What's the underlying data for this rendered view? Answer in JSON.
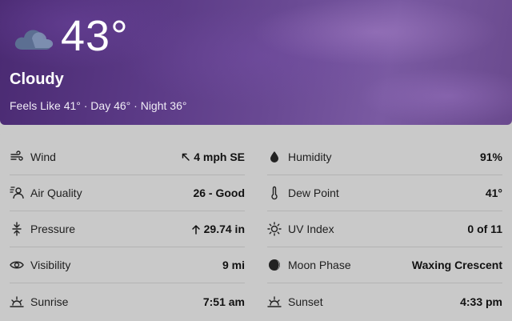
{
  "current": {
    "icon": "cloud-icon",
    "temperature": "43°",
    "condition": "Cloudy",
    "summary": "Feels Like 41° · Day 46° · Night 36°"
  },
  "details": {
    "left": [
      {
        "icon": "wind-icon",
        "label": "Wind",
        "value": "4 mph SE",
        "prefix_icon": "arrow-up-left-icon"
      },
      {
        "icon": "air-quality-icon",
        "label": "Air Quality",
        "value": "26 - Good"
      },
      {
        "icon": "pressure-icon",
        "label": "Pressure",
        "value": "29.74 in",
        "prefix_icon": "arrow-up-icon"
      },
      {
        "icon": "eye-icon",
        "label": "Visibility",
        "value": "9 mi"
      },
      {
        "icon": "sunrise-icon",
        "label": "Sunrise",
        "value": "7:51 am"
      }
    ],
    "right": [
      {
        "icon": "droplet-icon",
        "label": "Humidity",
        "value": "91%"
      },
      {
        "icon": "thermometer-icon",
        "label": "Dew Point",
        "value": "41°"
      },
      {
        "icon": "sun-outline-icon",
        "label": "UV Index",
        "value": "0 of 11"
      },
      {
        "icon": "moon-phase-icon",
        "label": "Moon Phase",
        "value": "Waxing Crescent"
      },
      {
        "icon": "sunset-icon",
        "label": "Sunset",
        "value": "4:33 pm"
      }
    ]
  },
  "colors": {
    "hero_accent": "#5b3a86",
    "panel_bg": "#c9c9c9",
    "text": "#111111"
  }
}
